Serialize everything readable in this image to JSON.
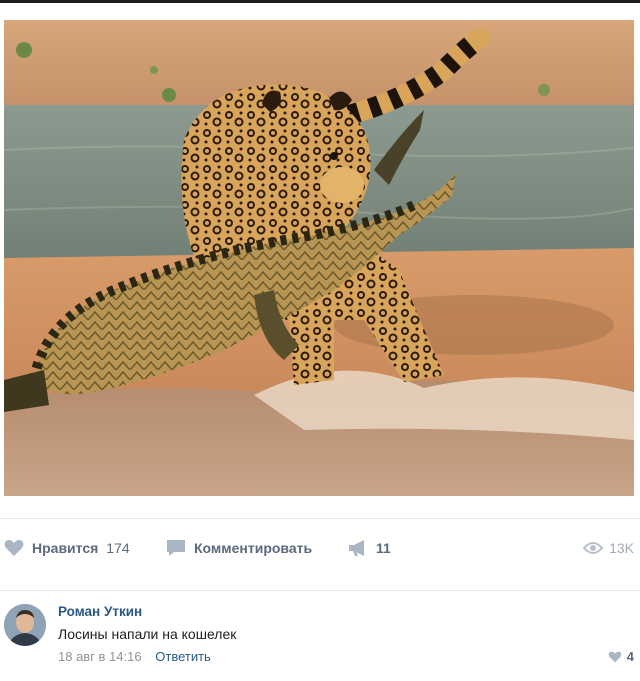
{
  "post": {
    "photo": {
      "description_icon": "jaguar-crocodile-photo"
    },
    "actions": {
      "like": {
        "label": "Нравится",
        "count": "174",
        "icon": "heart-icon"
      },
      "comment": {
        "label": "Комментировать",
        "icon": "comment-icon"
      },
      "share": {
        "count": "11",
        "icon": "megaphone-icon"
      },
      "views": {
        "count": "13K",
        "icon": "eye-icon"
      }
    }
  },
  "comment": {
    "author": "Роман Уткин",
    "text": "Лосины напали на кошелек",
    "date": "18 авг в 14:16",
    "reply_label": "Ответить",
    "likes": "4",
    "avatar_icon": "user-avatar"
  },
  "colors": {
    "link": "#2a5885",
    "action_text": "#5b6a7e",
    "muted": "#939393",
    "icon": "#aab6c4"
  }
}
